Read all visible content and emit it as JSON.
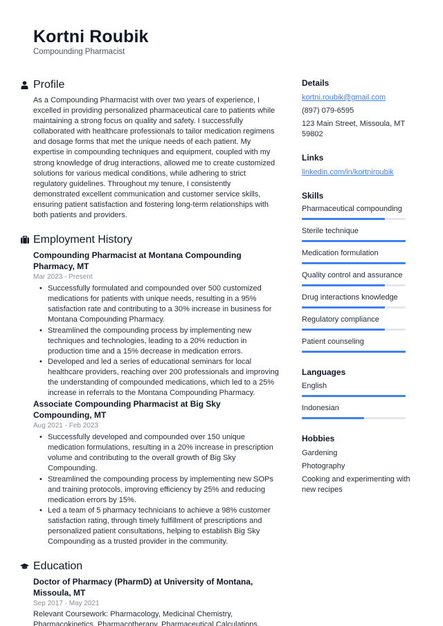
{
  "header": {
    "name": "Kortni Roubik",
    "title": "Compounding Pharmacist"
  },
  "profile": {
    "heading": "Profile",
    "icon": "person-icon",
    "text": "As a Compounding Pharmacist with over two years of experience, I excelled in providing personalized pharmaceutical care to patients while maintaining a strong focus on quality and safety. I successfully collaborated with healthcare professionals to tailor medication regimens and dosage forms that met the unique needs of each patient. My expertise in compounding techniques and equipment, coupled with my strong knowledge of drug interactions, allowed me to create customized solutions for various medical conditions, while adhering to strict regulatory guidelines. Throughout my tenure, I consistently demonstrated excellent communication and customer service skills, ensuring patient satisfaction and fostering long-term relationships with both patients and providers."
  },
  "employment": {
    "heading": "Employment History",
    "icon": "briefcase-icon",
    "jobs": [
      {
        "title": "Compounding Pharmacist at Montana Compounding Pharmacy, MT",
        "dates": "Mar 2023 - Present",
        "bullets": [
          "Successfully formulated and compounded over 500 customized medications for patients with unique needs, resulting in a 95% satisfaction rate and contributing to a 30% increase in business for Montana Compounding Pharmacy.",
          "Streamlined the compounding process by implementing new techniques and technologies, leading to a 20% reduction in production time and a 15% decrease in medication errors.",
          "Developed and led a series of educational seminars for local healthcare providers, reaching over 200 professionals and improving the understanding of compounded medications, which led to a 25% increase in referrals to the Montana Compounding Pharmacy."
        ]
      },
      {
        "title": "Associate Compounding Pharmacist at Big Sky Compounding, MT",
        "dates": "Aug 2021 - Feb 2023",
        "bullets": [
          "Successfully developed and compounded over 150 unique medication formulations, resulting in a 20% increase in prescription volume and contributing to the overall growth of Big Sky Compounding.",
          "Streamlined the compounding process by implementing new SOPs and training protocols, improving efficiency by 25% and reducing medication errors by 15%.",
          "Led a team of 5 pharmacy technicians to achieve a 98% customer satisfaction rating, through timely fulfillment of prescriptions and personalized patient consultations, helping to establish Big Sky Compounding as a trusted provider in the community."
        ]
      }
    ]
  },
  "education": {
    "heading": "Education",
    "icon": "graduation-cap-icon",
    "items": [
      {
        "title": "Doctor of Pharmacy (PharmD) at University of Montana, Missoula, MT",
        "dates": "Sep 2017 - May 2021",
        "text": "Relevant Coursework: Pharmacology, Medicinal Chemistry, Pharmacokinetics, Pharmacotherapy, Pharmaceutical Calculations,"
      }
    ]
  },
  "details": {
    "heading": "Details",
    "email": "kortni.roubik@gmail.com",
    "phone": "(897) 079-6595",
    "address": "123 Main Street, Missoula, MT 59802"
  },
  "links": {
    "heading": "Links",
    "items": [
      {
        "label": "linkedin.com/in/kortniroubik"
      }
    ]
  },
  "skills": {
    "heading": "Skills",
    "accent_color": "#3b82f6",
    "track_color": "#e5e7eb",
    "items": [
      {
        "label": "Pharmaceutical compounding",
        "level": 0.8
      },
      {
        "label": "Sterile technique",
        "level": 1.0
      },
      {
        "label": "Medication formulation",
        "level": 1.0
      },
      {
        "label": "Quality control and assurance",
        "level": 0.8
      },
      {
        "label": "Drug interactions knowledge",
        "level": 0.8
      },
      {
        "label": "Regulatory compliance",
        "level": 0.8
      },
      {
        "label": "Patient counseling",
        "level": 1.0
      }
    ]
  },
  "languages": {
    "heading": "Languages",
    "items": [
      {
        "label": "English",
        "level": 1.0
      },
      {
        "label": "Indonesian",
        "level": 0.6
      }
    ]
  },
  "hobbies": {
    "heading": "Hobbies",
    "items": [
      "Gardening",
      "Photography",
      "Cooking and experimenting with new recipes"
    ]
  }
}
